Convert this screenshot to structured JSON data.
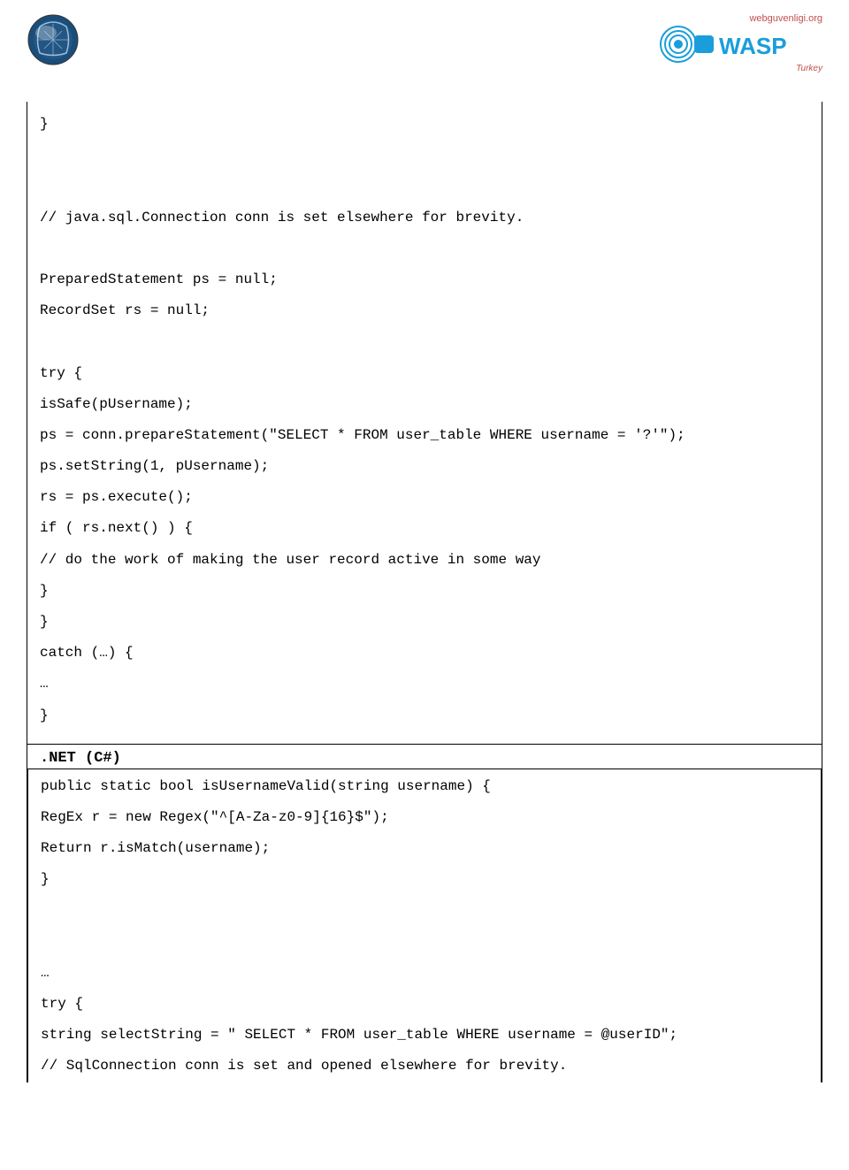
{
  "header": {
    "webguv": "webguvenligi.org",
    "turkey": "Turkey"
  },
  "java_code": {
    "l1": "}",
    "l2": "",
    "l3": "",
    "l4": "// java.sql.Connection conn is set elsewhere for brevity.",
    "l5": "",
    "l6": "PreparedStatement ps = null;",
    "l7": "RecordSet rs = null;",
    "l8": "",
    "l9": "try {",
    "l10": "isSafe(pUsername);",
    "l11": "ps = conn.prepareStatement(\"SELECT * FROM user_table WHERE username = '?'\");",
    "l12": "ps.setString(1, pUsername);",
    "l13": "rs = ps.execute();",
    "l14": "if ( rs.next() ) {",
    "l15": "// do the work of making the user record active in some way",
    "l16": "}",
    "l17": "}",
    "l18": "catch (…) {",
    "l19": "…",
    "l20": "}"
  },
  "net_heading": ".NET (C#)",
  "net_code": {
    "l1": "public static bool isUsernameValid(string username) {",
    "l2": "RegEx r = new Regex(\"^[A-Za-z0-9]{16}$\");",
    "l3": "Return r.isMatch(username);",
    "l4": "}",
    "l5": "",
    "l6": "",
    "l7": "…",
    "l8": "try {",
    "l9": "string selectString = \" SELECT * FROM user_table WHERE username = @userID\";",
    "l10": "// SqlConnection conn is set and opened elsewhere for brevity."
  }
}
